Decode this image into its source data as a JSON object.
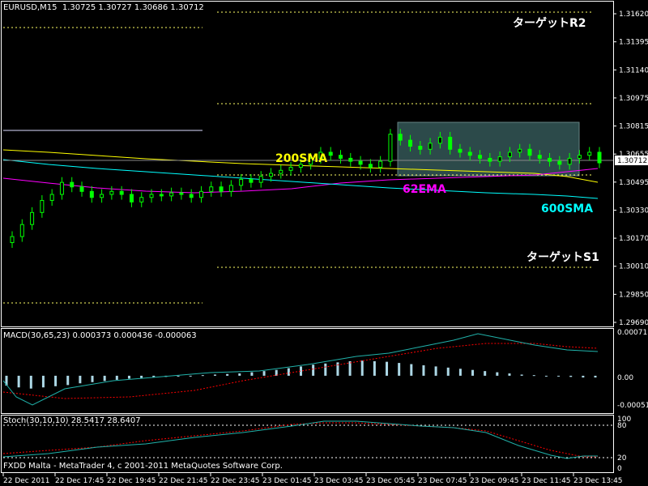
{
  "main": {
    "header": "EURUSD,M15  1.30725 1.30727 1.30686 1.30712",
    "price_ticks": [
      "1.31620",
      "1.31395",
      "1.31140",
      "1.30975",
      "1.30815",
      "1.30655",
      "1.30495",
      "1.30330",
      "1.30170",
      "1.30010",
      "1.29850",
      "1.29690"
    ],
    "current_price": "1.30712",
    "labels": {
      "target_r2": "ターゲットR2",
      "target_s1": "ターゲットS1",
      "sma200": "200SMA",
      "ema62": "62EMA",
      "sma600": "600SMA"
    }
  },
  "macd": {
    "header": "MACD(30,65,23) 0.000373 0.000436 -0.000063",
    "ticks": [
      "0.00071",
      "0.00",
      "-0.00051"
    ]
  },
  "stoch": {
    "header": "Stoch(30,10,10) 28.5417 28.6407",
    "ticks": [
      "100",
      "80",
      "20",
      "0"
    ]
  },
  "copyright": "FXDD Malta - MetaTrader 4, c 2001-2011 MetaQuotes Software Corp.",
  "time_axis": [
    "22 Dec 2011",
    "22 Dec 17:45",
    "22 Dec 19:45",
    "22 Dec 21:45",
    "22 Dec 23:45",
    "23 Dec 01:45",
    "23 Dec 03:45",
    "23 Dec 05:45",
    "23 Dec 07:45",
    "23 Dec 09:45",
    "23 Dec 11:45",
    "23 Dec 13:45"
  ],
  "colors": {
    "background": "#000000",
    "frame": "#ffffff",
    "candle": "#00ff00",
    "dotted": "#ffff66",
    "sma200": "#ffff00",
    "ema62": "#ff00ff",
    "sma600": "#00ffff",
    "highlight_box": "#2f4f4f",
    "macd_hist": "#add8e6",
    "signal": "#ff0000",
    "stoch_main": "#20b2aa"
  },
  "chart_data": [
    {
      "type": "candlestick",
      "title": "EURUSD,M15",
      "ylim": [
        1.2965,
        1.317
      ],
      "closes": [
        1.3022,
        1.303,
        1.3038,
        1.3046,
        1.305,
        1.3058,
        1.3055,
        1.3052,
        1.3048,
        1.305,
        1.3052,
        1.305,
        1.3045,
        1.3048,
        1.305,
        1.3049,
        1.3051,
        1.305,
        1.3048,
        1.3052,
        1.3055,
        1.3052,
        1.3056,
        1.306,
        1.3058,
        1.3062,
        1.3064,
        1.3066,
        1.3068,
        1.307,
        1.3074,
        1.3078,
        1.3076,
        1.3074,
        1.3072,
        1.307,
        1.3068,
        1.3072,
        1.309,
        1.3086,
        1.3082,
        1.308,
        1.3084,
        1.3088,
        1.308,
        1.3078,
        1.3076,
        1.3074,
        1.3072,
        1.3075,
        1.3078,
        1.308,
        1.3076,
        1.3074,
        1.3072,
        1.307,
        1.3074,
        1.3076,
        1.3078,
        1.3071
      ],
      "sma200": [
        1.3083,
        1.308,
        1.3076,
        1.307,
        1.3066,
        1.3062
      ],
      "ema62": [
        1.306,
        1.3055,
        1.3052,
        1.3051,
        1.3056,
        1.3062,
        1.3066,
        1.3068,
        1.307
      ],
      "sma600": [
        1.3068,
        1.3066,
        1.3063,
        1.306,
        1.3057,
        1.3054,
        1.3051,
        1.3047
      ],
      "levels": {
        "target_r2": 1.3162,
        "target_s1": 1.3
      },
      "current": 1.30712
    },
    {
      "type": "bar",
      "title": "MACD(30,65,23)",
      "values": [
        -0.00017,
        -0.0002,
        -0.00022,
        -0.0002,
        -0.00018,
        -0.00016,
        -0.00013,
        -0.00011,
        -9e-05,
        -7e-05,
        -5e-05,
        -4e-05,
        -3e-05,
        -2e-05,
        -1e-05,
        0.0,
        1e-05,
        2e-05,
        3e-05,
        4e-05,
        6e-05,
        8e-05,
        0.0001,
        0.00013,
        0.00016,
        0.00019,
        0.00021,
        0.00023,
        0.00025,
        0.00026,
        0.00025,
        0.00024,
        0.00022,
        0.0002,
        0.00018,
        0.00016,
        0.00014,
        0.00012,
        0.0001,
        8e-05,
        6e-05,
        4e-05,
        2e-05,
        1e-05,
        0.0,
        -1e-05,
        -2e-05,
        -3e-05,
        -3e-05
      ],
      "signal": [
        -0.0004,
        -0.00035,
        -0.00025,
        -0.0001,
        5e-05,
        0.00015,
        0.00025,
        0.0004,
        0.0005,
        0.0006,
        0.0006,
        0.0005,
        0.0005
      ],
      "main": [
        -0.00051,
        -0.0002,
        0.0,
        0.0001,
        0.0002,
        0.0003,
        0.0004,
        0.00055,
        0.0007,
        0.00065,
        0.00055,
        0.0005,
        0.00045
      ],
      "ylim": [
        -0.0006,
        0.00075
      ]
    },
    {
      "type": "line",
      "title": "Stoch(30,10,10)",
      "series": [
        {
          "name": "main",
          "values": [
            45,
            40,
            42,
            50,
            58,
            70,
            82,
            92,
            95,
            90,
            85,
            70,
            50,
            30,
            22,
            28
          ]
        },
        {
          "name": "signal",
          "values": [
            35,
            38,
            42,
            48,
            56,
            66,
            78,
            88,
            93,
            92,
            87,
            75,
            58,
            40,
            28,
            24
          ]
        }
      ],
      "levels": [
        80,
        20
      ],
      "ylim": [
        0,
        100
      ]
    }
  ]
}
